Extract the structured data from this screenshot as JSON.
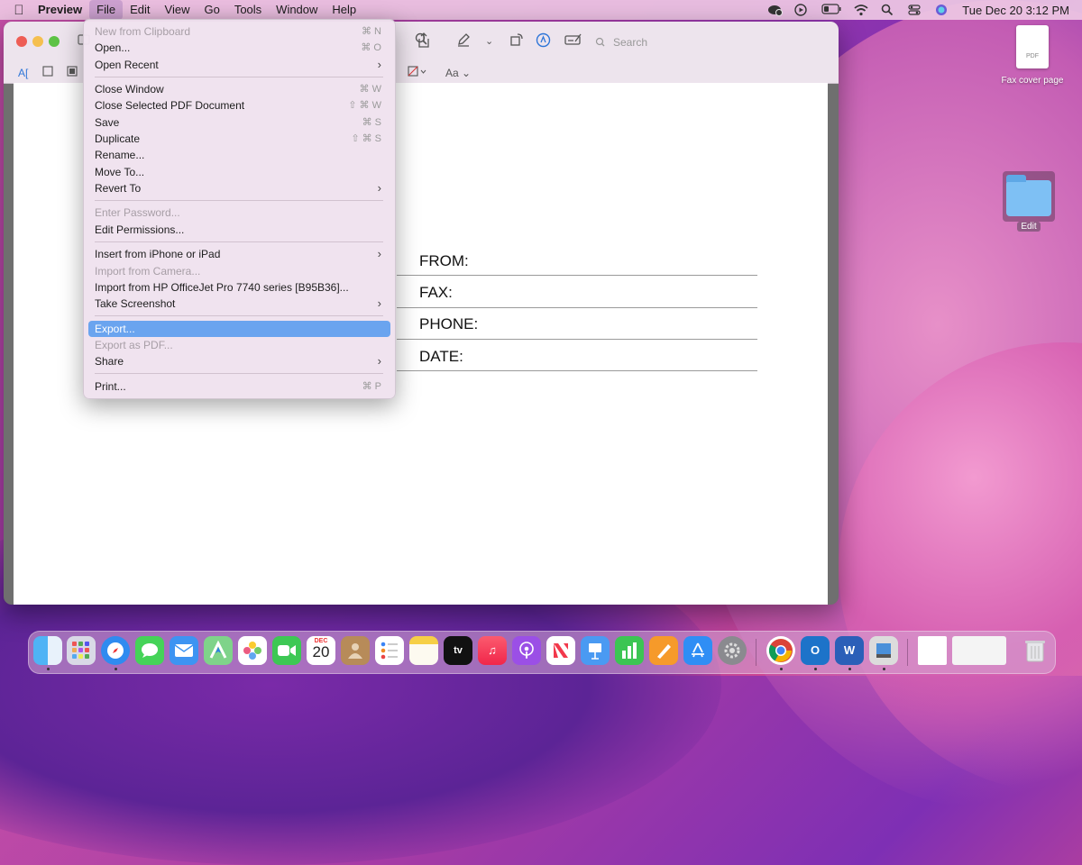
{
  "menubar": {
    "app_name": "Preview",
    "items": [
      "File",
      "Edit",
      "View",
      "Go",
      "Tools",
      "Window",
      "Help"
    ],
    "clock": "Tue Dec 20  3:12 PM"
  },
  "window": {
    "search_placeholder": "Search",
    "text_size_label": "Aa"
  },
  "document": {
    "fields": [
      "FROM:",
      "FAX:",
      "PHONE:",
      "DATE:"
    ]
  },
  "file_menu": {
    "items": [
      {
        "label": "New from Clipboard",
        "shortcut": "⌘ N",
        "disabled": true
      },
      {
        "label": "Open...",
        "shortcut": "⌘ O"
      },
      {
        "label": "Open Recent",
        "submenu": true
      },
      {
        "label": "Close Window",
        "shortcut": "⌘ W"
      },
      {
        "label": "Close Selected PDF Document",
        "shortcut": "⇧ ⌘ W"
      },
      {
        "label": "Save",
        "shortcut": "⌘ S"
      },
      {
        "label": "Duplicate",
        "shortcut": "⇧ ⌘ S"
      },
      {
        "label": "Rename..."
      },
      {
        "label": "Move To..."
      },
      {
        "label": "Revert To",
        "submenu": true
      },
      {
        "label": "Enter Password...",
        "disabled": true
      },
      {
        "label": "Edit Permissions..."
      },
      {
        "label": "Insert from iPhone or iPad",
        "submenu": true
      },
      {
        "label": "Import from Camera...",
        "disabled": true
      },
      {
        "label": "Import from HP OfficeJet Pro 7740 series [B95B36]..."
      },
      {
        "label": "Take Screenshot",
        "submenu": true
      },
      {
        "label": "Export...",
        "highlighted": true
      },
      {
        "label": "Export as PDF...",
        "disabled": true
      },
      {
        "label": "Share",
        "submenu": true
      },
      {
        "label": "Print...",
        "shortcut": "⌘ P"
      }
    ]
  },
  "desktop": {
    "file_label": "Fax cover page",
    "file_badge": "PDF",
    "folder_label": "Edit"
  },
  "dock": {
    "calendar_month": "DEC",
    "calendar_day": "20",
    "apps": [
      "Finder",
      "Launchpad",
      "Safari",
      "Messages",
      "Mail",
      "Maps",
      "Photos",
      "FaceTime",
      "Calendar",
      "Contacts",
      "Reminders",
      "Notes",
      "TV",
      "Music",
      "Podcasts",
      "News",
      "Keynote",
      "Numbers",
      "Pages",
      "App Store",
      "System Preferences",
      "Chrome",
      "Outlook",
      "Word",
      "Preview",
      "Document",
      "Downloads",
      "Trash"
    ]
  }
}
